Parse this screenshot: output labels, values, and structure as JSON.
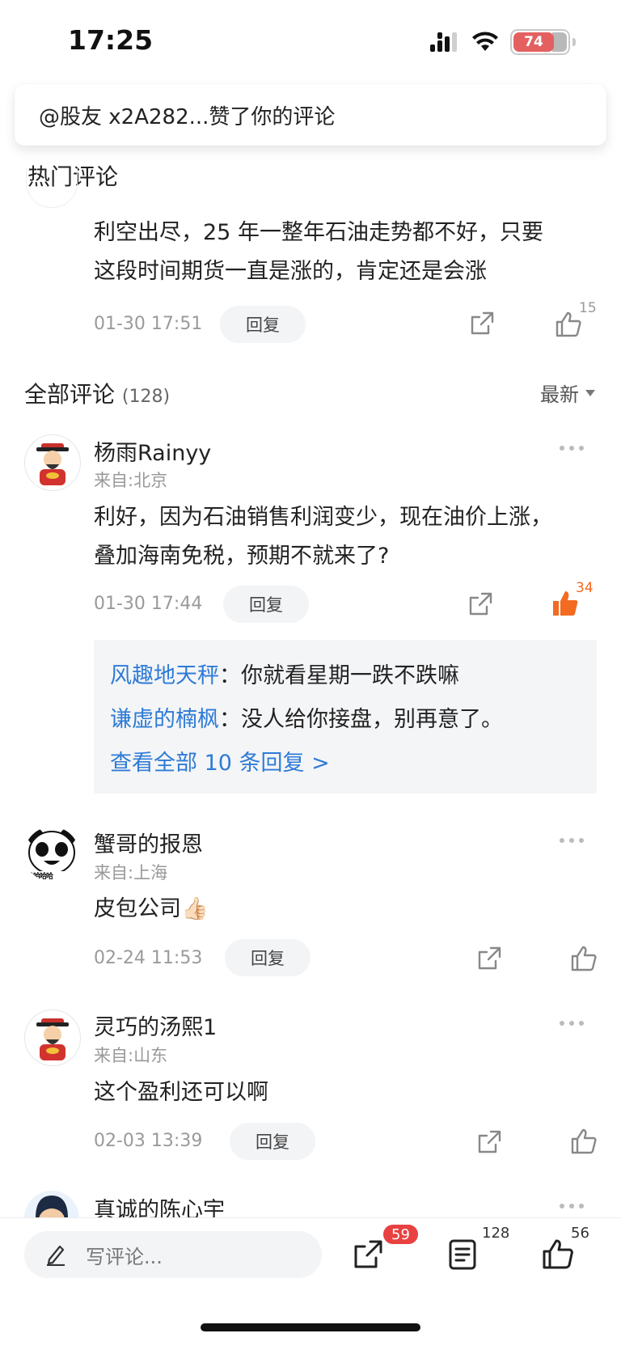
{
  "status_bar": {
    "time": "17:25",
    "battery": "74"
  },
  "toast": {
    "text": "@股友 x2A282...赞了你的评论"
  },
  "hot": {
    "title": "热门评论",
    "comment": {
      "text_line1": "利空出尽，25 年一整年石油走势都不好，只要",
      "text_line2": "这段时间期货一直是涨的，肯定还是会涨",
      "time": "01-30 17:51",
      "reply_label": "回复",
      "likes": "15"
    }
  },
  "all": {
    "title": "全部评论",
    "count": "(128)",
    "sort": "最新"
  },
  "comments": [
    {
      "username": "杨雨Rainyy",
      "location": "来自:北京",
      "text_line1": "利好，因为石油销售利润变少，现在油价上涨，",
      "text_line2": "叠加海南免税，预期不就来了?",
      "time": "01-30 17:44",
      "reply_label": "回复",
      "likes": "34",
      "replies": [
        {
          "name": "风趣地天秤",
          "sep": "：",
          "text": "你就看星期一跌不跌嘛"
        },
        {
          "name": "谦虚的楠枫",
          "sep": "：",
          "text": "没人给你接盘，别再意了。"
        }
      ],
      "view_all": "查看全部 10 条回复 >"
    },
    {
      "username": "蟹哥的报恩",
      "location": "来自:上海",
      "text": "皮包公司👍🏻",
      "time": "02-24 11:53",
      "reply_label": "回复",
      "avatar_caption": "哈哈哈哈"
    },
    {
      "username": "灵巧的汤熙1",
      "location": "来自:山东",
      "text": "这个盈利还可以啊",
      "time": "02-03 13:39",
      "reply_label": "回复"
    },
    {
      "username": "真诚的陈心宇"
    }
  ],
  "bottom_bar": {
    "input_placeholder": "写评论...",
    "share_badge": "59",
    "comments_count": "128",
    "likes_count": "56"
  },
  "colors": {
    "accent_blue": "#2e7bd6",
    "like_orange": "#f26b21",
    "badge_red": "#e94141"
  },
  "icons": [
    "signal-icon",
    "wifi-icon",
    "battery-icon",
    "share-icon",
    "like-icon",
    "more-icon",
    "pencil-icon",
    "comment-list-icon"
  ]
}
